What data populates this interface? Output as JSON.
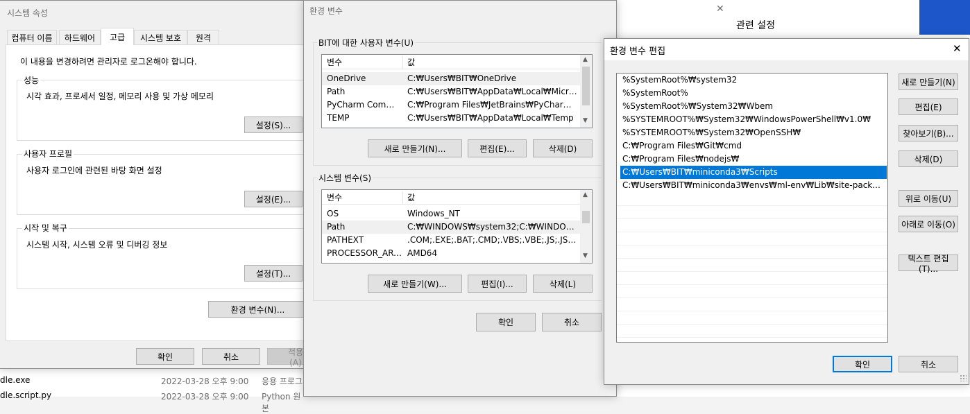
{
  "background": {
    "settings_label": "관련 설정",
    "explorer_rows": [
      {
        "name": "dle.exe",
        "date": "2022-03-28 오후 9:00",
        "type": "응용 프로그"
      },
      {
        "name": "dle.script.py",
        "date": "2022-03-28 오후 9:00",
        "type": "Python 원본"
      }
    ]
  },
  "system_properties": {
    "title": "시스템 속성",
    "tabs": [
      "컴퓨터 이름",
      "하드웨어",
      "고급",
      "시스템 보호",
      "원격"
    ],
    "admin_note": "이 내용을 변경하려면 관리자로 로그온해야 합니다.",
    "performance": {
      "title": "성능",
      "desc": "시각 효과, 프로세서 일정, 메모리 사용 및 가상 메모리",
      "button": "설정(S)..."
    },
    "user_profile": {
      "title": "사용자 프로필",
      "desc": "사용자 로그인에 관련된 바탕 화면 설정",
      "button": "설정(E)..."
    },
    "startup": {
      "title": "시작 및 복구",
      "desc": "시스템 시작, 시스템 오류 및 디버깅 정보",
      "button": "설정(T)..."
    },
    "env_button": "환경 변수(N)...",
    "ok": "확인",
    "cancel": "취소",
    "apply": "적용(A)"
  },
  "env_vars": {
    "title": "환경 변수",
    "close": "✕",
    "user_section_title": "BIT에 대한 사용자 변수(U)",
    "col_var": "변수",
    "col_val": "값",
    "user_rows": [
      {
        "name": "OneDrive",
        "value": "C:₩Users₩BIT₩OneDrive"
      },
      {
        "name": "Path",
        "value": "C:₩Users₩BIT₩AppData₩Local₩Microsoft..."
      },
      {
        "name": "PyCharm Commu...",
        "value": "C:₩Program Files₩JetBrains₩PyCharm Co..."
      },
      {
        "name": "TEMP",
        "value": "C:₩Users₩BIT₩AppData₩Local₩Temp"
      }
    ],
    "user_new": "새로 만들기(N)...",
    "user_edit": "편집(E)...",
    "user_delete": "삭제(D)",
    "system_section_title": "시스템 변수(S)",
    "system_rows": [
      {
        "name": "OS",
        "value": "Windows_NT"
      },
      {
        "name": "Path",
        "value": "C:₩WINDOWS₩system32;C:₩WINDOWS;C..."
      },
      {
        "name": "PATHEXT",
        "value": ".COM;.EXE;.BAT;.CMD;.VBS;.VBE;.JS;.JSE;.W..."
      },
      {
        "name": "PROCESSOR_ARC...",
        "value": "AMD64"
      }
    ],
    "system_new": "새로 만들기(W)...",
    "system_edit": "편집(I)...",
    "system_delete": "삭제(L)",
    "ok": "확인",
    "cancel": "취소"
  },
  "edit_env": {
    "title": "환경 변수 편집",
    "close": "✕",
    "entries": [
      "%SystemRoot%₩system32",
      "%SystemRoot%",
      "%SystemRoot%₩System32₩Wbem",
      "%SYSTEMROOT%₩System32₩WindowsPowerShell₩v1.0₩",
      "%SYSTEMROOT%₩System32₩OpenSSH₩",
      "C:₩Program Files₩Git₩cmd",
      "C:₩Program Files₩nodejs₩",
      "C:₩Users₩BIT₩miniconda3₩Scripts",
      "C:₩Users₩BIT₩miniconda3₩envs₩ml-env₩Lib₩site-packages₩grap..."
    ],
    "selected_index": 7,
    "buttons": {
      "new": "새로 만들기(N)",
      "edit": "편집(E)",
      "browse": "찾아보기(B)...",
      "delete": "삭제(D)",
      "move_up": "위로 이동(U)",
      "move_down": "아래로 이동(O)",
      "edit_text": "텍스트 편집(T)..."
    },
    "ok": "확인",
    "cancel": "취소"
  },
  "colors": {
    "selection": "#0078d7",
    "accent_blue": "#1c56c8",
    "dialog_bg": "#f0f0f0"
  }
}
